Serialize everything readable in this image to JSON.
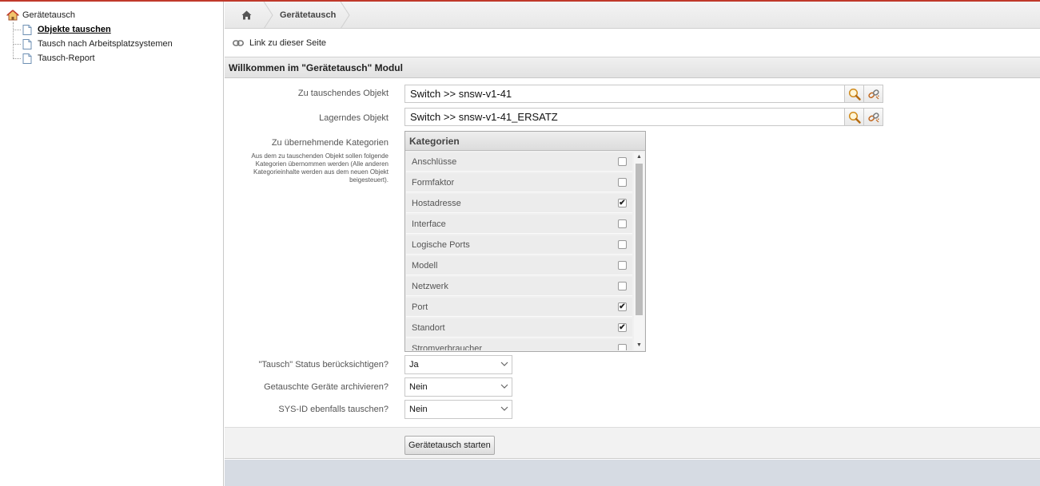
{
  "tree": {
    "root": "Gerätetausch",
    "items": [
      {
        "label": "Objekte tauschen",
        "active": true
      },
      {
        "label": "Tausch nach Arbeitsplatzsystemen",
        "active": false
      },
      {
        "label": "Tausch-Report",
        "active": false
      }
    ]
  },
  "breadcrumb": {
    "title": "Gerätetausch",
    "home_icon": "home-icon"
  },
  "link_row": {
    "label": "Link zu dieser Seite",
    "icon": "chain-link-icon"
  },
  "module_header": "Willkommen im \"Gerätetausch\" Modul",
  "form": {
    "swap_object": {
      "label": "Zu tauschendes Objekt",
      "value": "Switch >> snsw-v1-41"
    },
    "stock_object": {
      "label": "Lagerndes Objekt",
      "value": "Switch >> snsw-v1-41_ERSATZ"
    },
    "categories": {
      "label": "Zu übernehmende Kategorien",
      "description": "Aus dem zu tauschenden Objekt sollen folgende Kategorien übernommen werden (Alle anderen Kategorieinhalte werden aus dem neuen Objekt beigesteuert).",
      "header": "Kategorien",
      "items": [
        {
          "label": "Anschlüsse",
          "checked": false
        },
        {
          "label": "Formfaktor",
          "checked": false
        },
        {
          "label": "Hostadresse",
          "checked": true
        },
        {
          "label": "Interface",
          "checked": false
        },
        {
          "label": "Logische Ports",
          "checked": false
        },
        {
          "label": "Modell",
          "checked": false
        },
        {
          "label": "Netzwerk",
          "checked": false
        },
        {
          "label": "Port",
          "checked": true
        },
        {
          "label": "Standort",
          "checked": true
        },
        {
          "label": "Stromverbraucher",
          "checked": false
        }
      ]
    },
    "swap_status": {
      "label": "\"Tausch\" Status berücksichtigen?",
      "value": "Ja"
    },
    "archive": {
      "label": "Getauschte Geräte archivieren?",
      "value": "Nein"
    },
    "sysid": {
      "label": "SYS-ID ebenfalls tauschen?",
      "value": "Nein"
    },
    "start_button": "Gerätetausch starten"
  },
  "colors": {
    "accent_top": "#c0392b",
    "bottom_fill": "#d6dbe3"
  }
}
